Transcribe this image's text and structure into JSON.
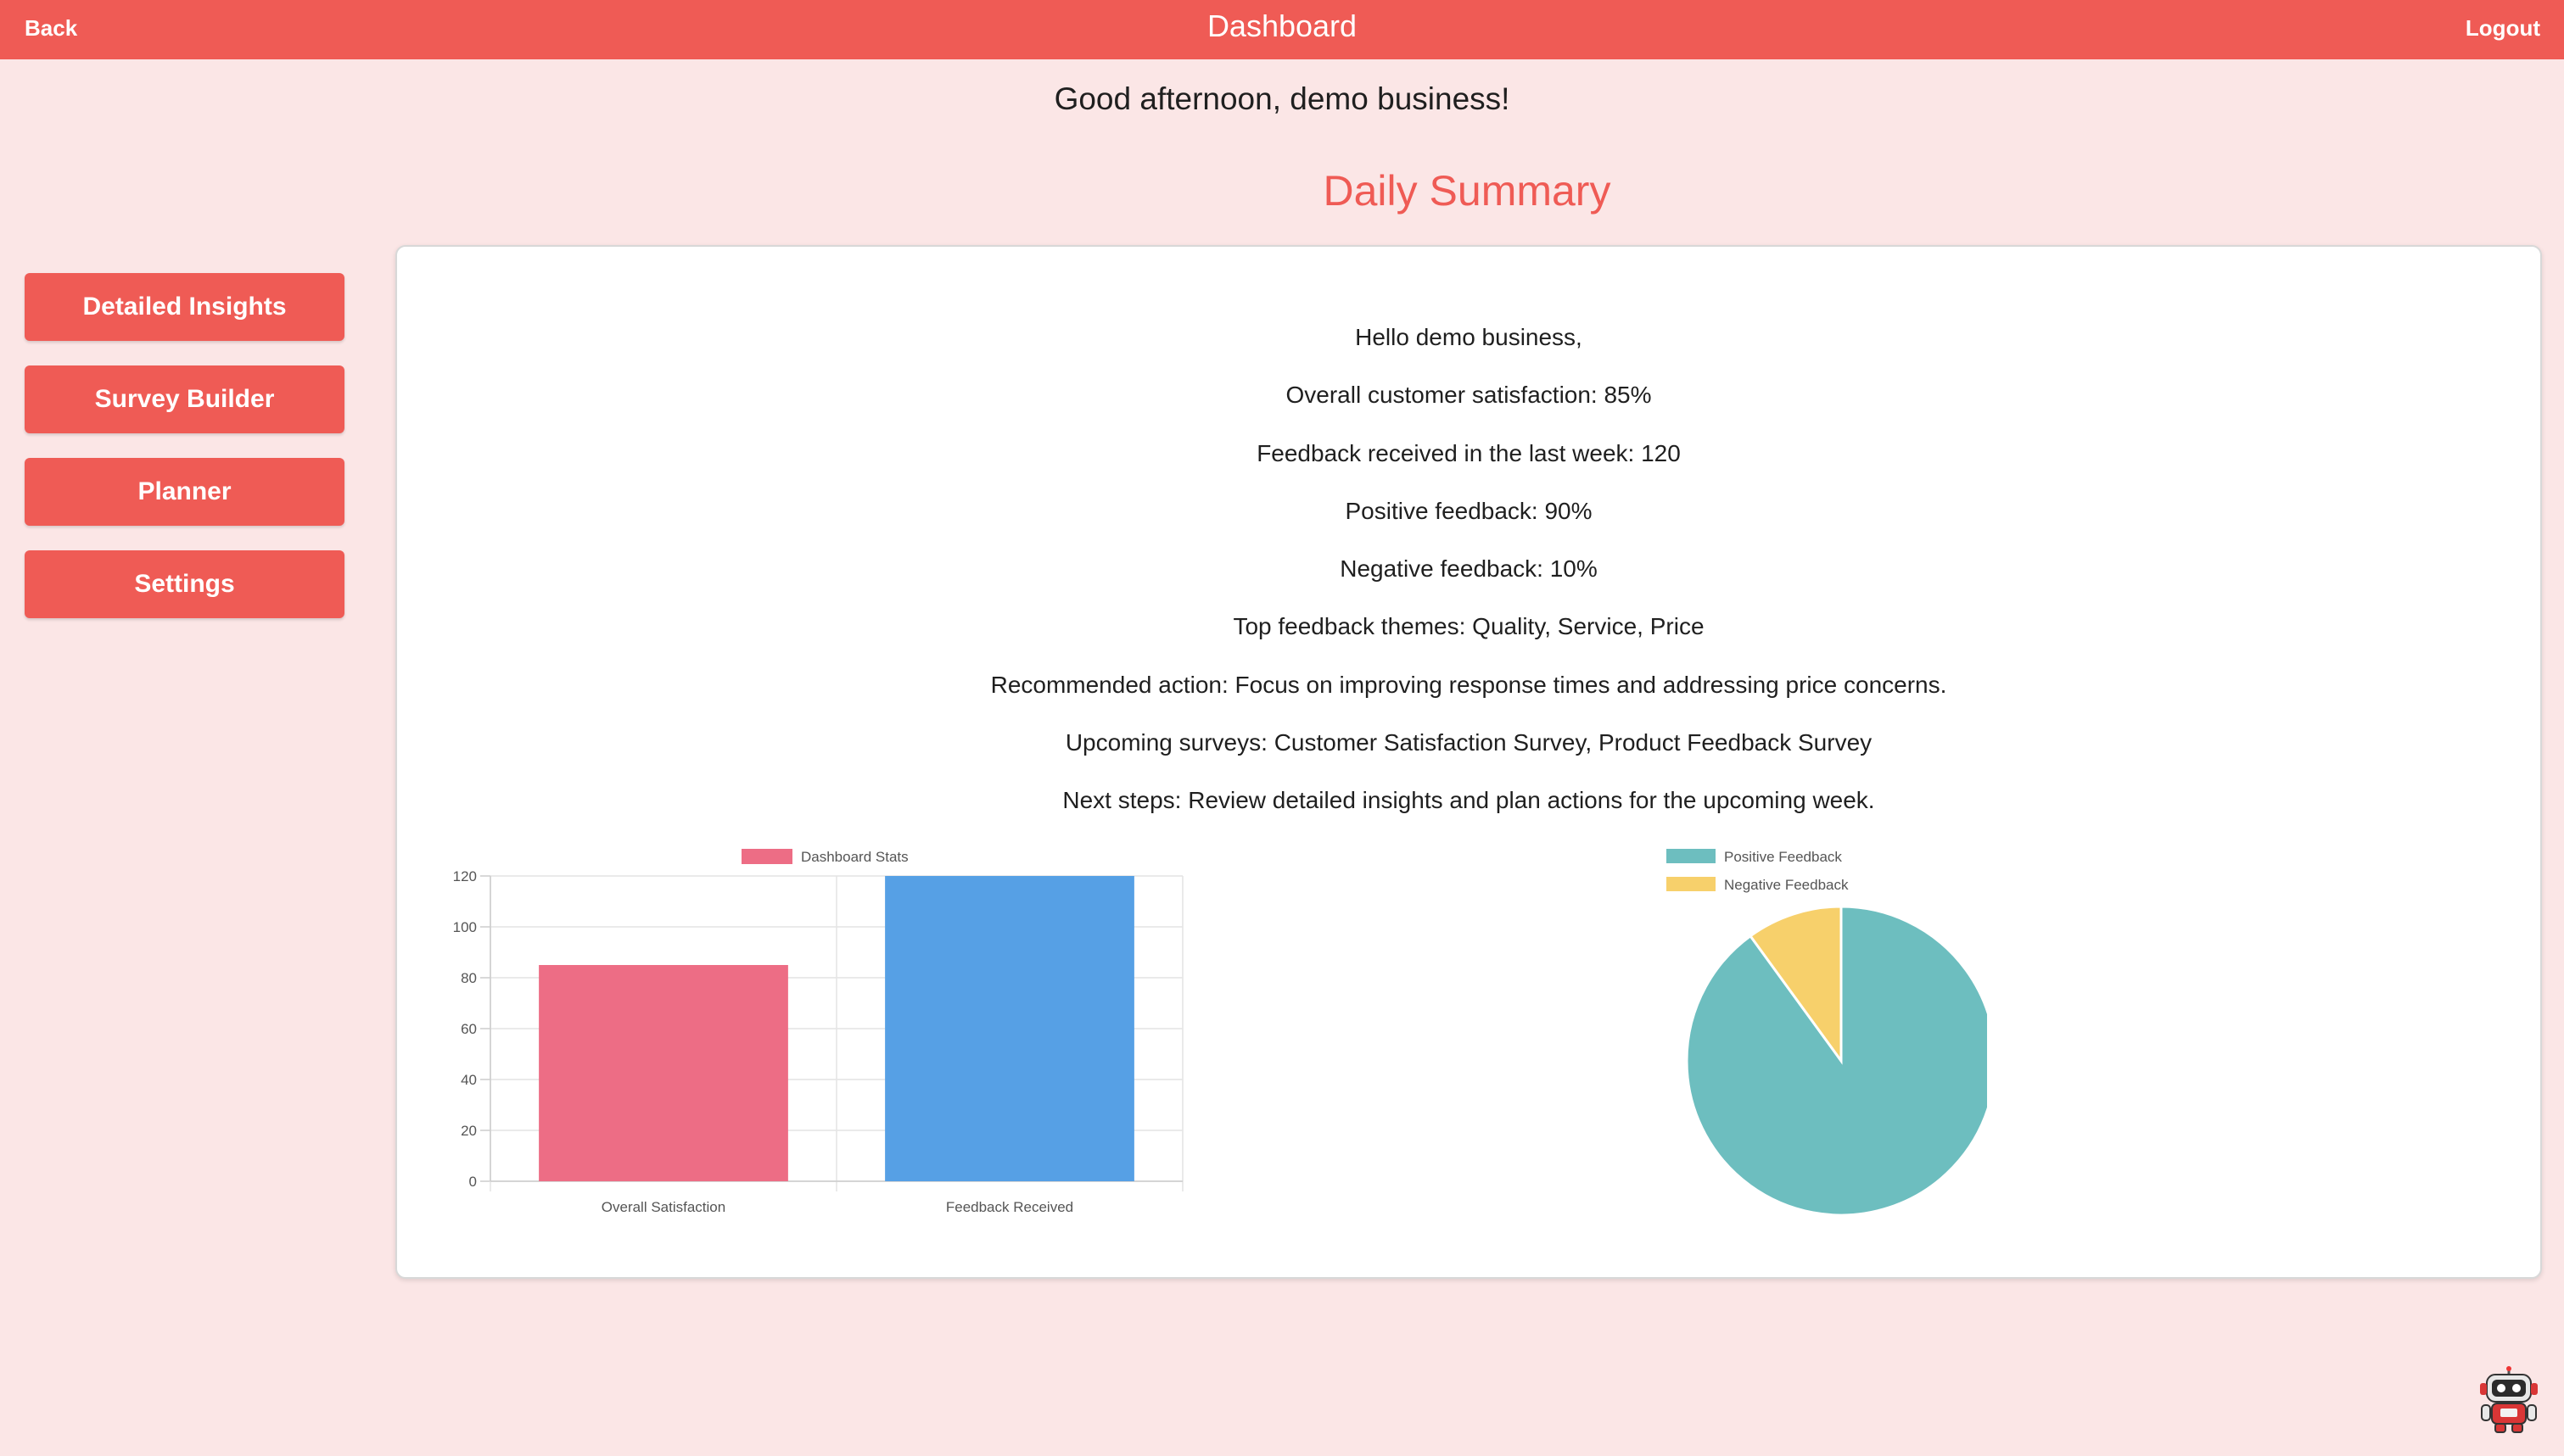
{
  "header": {
    "back_label": "Back",
    "title": "Dashboard",
    "logout_label": "Logout",
    "bar_color": "#ef5b55"
  },
  "greeting": "Good afternoon, demo business!",
  "summary_title": "Daily Summary",
  "sidebar": {
    "items": [
      {
        "label": "Detailed Insights"
      },
      {
        "label": "Survey Builder"
      },
      {
        "label": "Planner"
      },
      {
        "label": "Settings"
      }
    ]
  },
  "summary": {
    "lines": [
      "Hello demo business,",
      "Overall customer satisfaction: 85%",
      "Feedback received in the last week: 120",
      "Positive feedback: 90%",
      "Negative feedback: 10%",
      "Top feedback themes: Quality, Service, Price",
      "Recommended action: Focus on improving response times and addressing price concerns.",
      "Upcoming surveys: Customer Satisfaction Survey, Product Feedback Survey",
      "Next steps: Review detailed insights and plan actions for the upcoming week."
    ]
  },
  "chart_data": [
    {
      "type": "bar",
      "legend": "Dashboard Stats",
      "categories": [
        "Overall Satisfaction",
        "Feedback Received"
      ],
      "values": [
        85,
        120
      ],
      "colors": [
        "#ed6d85",
        "#56a0e5"
      ],
      "ylim": [
        0,
        120
      ],
      "yticks": [
        0,
        20,
        40,
        60,
        80,
        100,
        120
      ],
      "grid": true,
      "legend_position": "top"
    },
    {
      "type": "pie",
      "labels": [
        "Positive Feedback",
        "Negative Feedback"
      ],
      "values": [
        90,
        10
      ],
      "colors": [
        "#6dbebf",
        "#f7d06b"
      ],
      "legend_position": "top"
    }
  ],
  "assistant": {
    "icon": "robot-icon"
  }
}
